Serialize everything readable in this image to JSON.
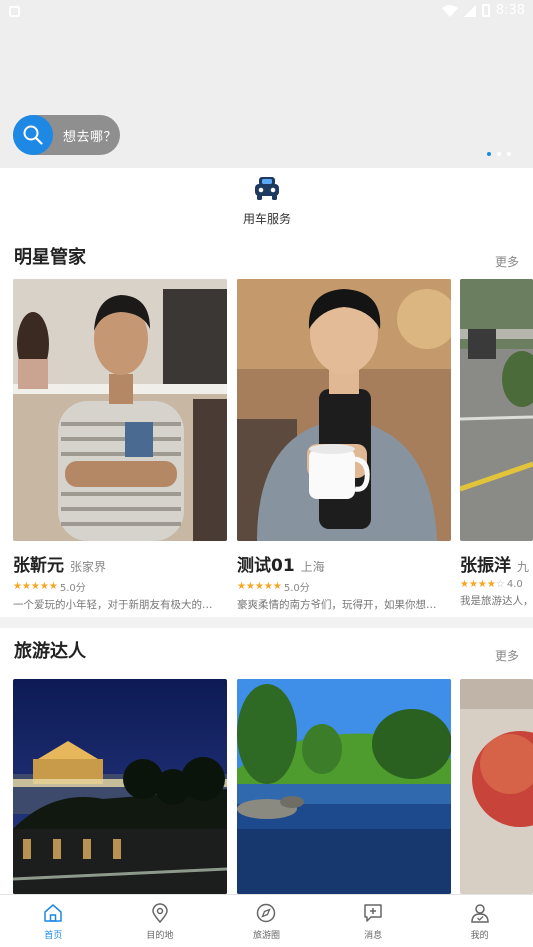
{
  "status_bar": {
    "time": "8:38"
  },
  "search": {
    "placeholder": "想去哪？"
  },
  "banner": {
    "page_count": 3,
    "active_index": 0
  },
  "service": {
    "label": "用车服务"
  },
  "sections": [
    {
      "title": "明星管家",
      "more": "更多",
      "cards": [
        {
          "name": "张靳元",
          "location": "张家界",
          "stars": 5,
          "score": "5.0分",
          "desc": "一个爱玩的小年轻，对于新朋友有极大的…"
        },
        {
          "name": "测试01",
          "location": "上海",
          "stars": 5,
          "score": "5.0分",
          "desc": "豪爽柔情的南方爷们，玩得开，如果你想…"
        },
        {
          "name": "张振洋",
          "location": "九",
          "stars": 4,
          "score": "4.0",
          "desc": "我是旅游达人，"
        }
      ]
    },
    {
      "title": "旅游达人",
      "more": "更多"
    }
  ],
  "bottom_nav": [
    {
      "label": "首页",
      "icon": "home-icon",
      "active": true
    },
    {
      "label": "目的地",
      "icon": "location-pin-icon",
      "active": false
    },
    {
      "label": "旅游圈",
      "icon": "compass-icon",
      "active": false
    },
    {
      "label": "消息",
      "icon": "message-plus-icon",
      "active": false
    },
    {
      "label": "我的",
      "icon": "user-icon",
      "active": false
    }
  ],
  "colors": {
    "accent": "#1e88e5",
    "star": "#f6a623"
  }
}
